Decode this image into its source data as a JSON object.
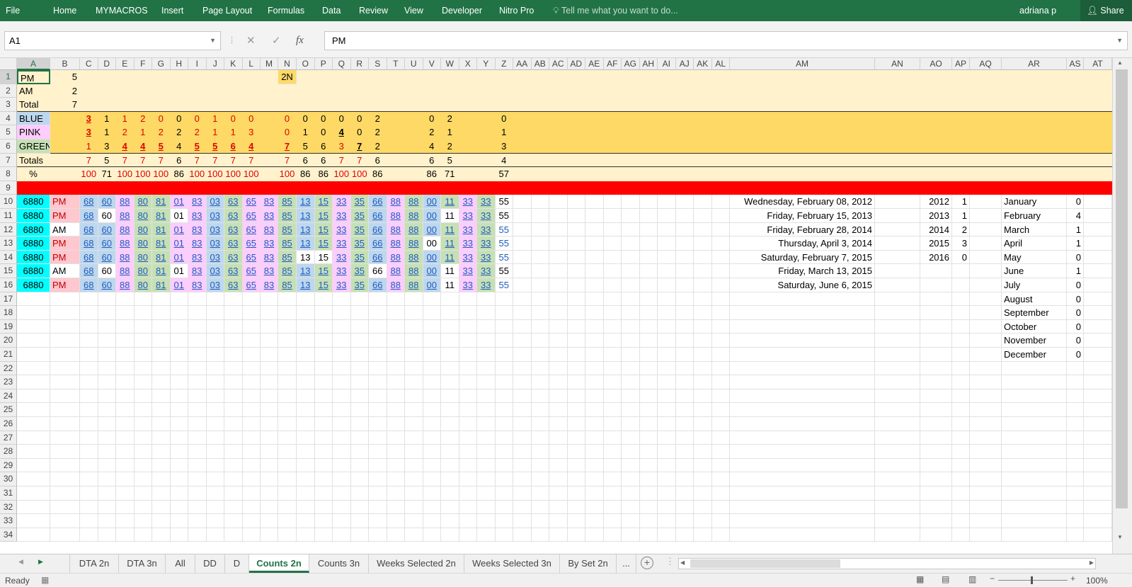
{
  "ribbon": {
    "tabs": [
      "File",
      "Home",
      "MYMACROS",
      "Insert",
      "Page Layout",
      "Formulas",
      "Data",
      "Review",
      "View",
      "Developer",
      "Nitro Pro"
    ],
    "tell_me": "Tell me what you want to do...",
    "user": "adriana p",
    "share": "Share"
  },
  "formula_bar": {
    "name_box": "A1",
    "formula": "PM",
    "fx": "fx"
  },
  "columns": [
    "A",
    "B",
    "C",
    "D",
    "E",
    "F",
    "G",
    "H",
    "I",
    "J",
    "K",
    "L",
    "M",
    "N",
    "O",
    "P",
    "Q",
    "R",
    "S",
    "T",
    "U",
    "V",
    "W",
    "X",
    "Y",
    "Z",
    "AA",
    "AB",
    "AC",
    "AD",
    "AE",
    "AF",
    "AG",
    "AH",
    "AI",
    "AJ",
    "AK",
    "AL",
    "AM",
    "AN",
    "AO",
    "AP",
    "AQ",
    "AR",
    "AS",
    "AT"
  ],
  "row_numbers": [
    "1",
    "2",
    "3",
    "4",
    "5",
    "6",
    "7",
    "8",
    "9",
    "10",
    "11",
    "12",
    "13",
    "14",
    "15",
    "16",
    "17",
    "18",
    "19",
    "20",
    "21",
    "22",
    "23",
    "24",
    "25",
    "26",
    "27",
    "28",
    "29",
    "30",
    "31",
    "32",
    "33",
    "34"
  ],
  "colors": {
    "header_bg": "#efefef",
    "band_light": "#fff2cc",
    "band_gold": "#ffd966",
    "red_row": "#ff0000",
    "cyan": "#00ffff",
    "blue": "#bdd7ee",
    "pink": "#ffccff",
    "green": "#c6e0b4",
    "ribbon": "#217346"
  },
  "sheet": {
    "summary": [
      {
        "label": "PM",
        "b": "5",
        "extra": {
          "N": "2N"
        }
      },
      {
        "label": "AM",
        "b": "2"
      },
      {
        "label": "Total",
        "b": "7"
      }
    ],
    "color_rows": [
      {
        "label": "BLUE",
        "values": [
          "3",
          "1",
          "1",
          "2",
          "0",
          "0",
          "0",
          "1",
          "0",
          "0",
          "",
          "0",
          "0",
          "0",
          "0",
          "0",
          "2",
          "",
          "",
          "0",
          "2",
          "",
          "",
          "0"
        ]
      },
      {
        "label": "PINK",
        "values": [
          "3",
          "1",
          "2",
          "1",
          "2",
          "2",
          "2",
          "1",
          "1",
          "3",
          "",
          "0",
          "1",
          "0",
          "4",
          "0",
          "2",
          "",
          "",
          "2",
          "1",
          "",
          "",
          "1"
        ]
      },
      {
        "label": "GREEN",
        "values": [
          "1",
          "3",
          "4",
          "4",
          "5",
          "4",
          "5",
          "5",
          "6",
          "4",
          "",
          "7",
          "5",
          "6",
          "3",
          "7",
          "2",
          "",
          "",
          "4",
          "2",
          "",
          "",
          "3"
        ]
      }
    ],
    "totals": {
      "label": "Totals",
      "values": [
        "7",
        "5",
        "7",
        "7",
        "7",
        "6",
        "7",
        "7",
        "7",
        "7",
        "",
        "7",
        "6",
        "6",
        "7",
        "7",
        "6",
        "",
        "",
        "6",
        "5",
        "",
        "",
        "4"
      ]
    },
    "percent": {
      "label": "%",
      "values": [
        "100",
        "71",
        "100",
        "100",
        "100",
        "86",
        "100",
        "100",
        "100",
        "100",
        "",
        "100",
        "86",
        "86",
        "100",
        "100",
        "86",
        "",
        "",
        "86",
        "71",
        "",
        "",
        "57"
      ]
    },
    "draws": [
      {
        "id": "6880",
        "ampm": "PM",
        "nums": [
          "68",
          "60",
          "88",
          "80",
          "81",
          "01",
          "83",
          "03",
          "63",
          "65",
          "83",
          "85",
          "13",
          "15",
          "33",
          "35",
          "66",
          "88",
          "88",
          "00",
          "11",
          "33",
          "33",
          "55"
        ]
      },
      {
        "id": "6880",
        "ampm": "PM",
        "nums": [
          "68",
          "60",
          "88",
          "80",
          "81",
          "01",
          "83",
          "03",
          "63",
          "65",
          "83",
          "85",
          "13",
          "15",
          "33",
          "35",
          "66",
          "88",
          "88",
          "00",
          "11",
          "33",
          "33",
          "55"
        ]
      },
      {
        "id": "6880",
        "ampm": "AM",
        "nums": [
          "68",
          "60",
          "88",
          "80",
          "81",
          "01",
          "83",
          "03",
          "63",
          "65",
          "83",
          "85",
          "13",
          "15",
          "33",
          "35",
          "66",
          "88",
          "88",
          "00",
          "11",
          "33",
          "33",
          "55"
        ]
      },
      {
        "id": "6880",
        "ampm": "PM",
        "nums": [
          "68",
          "60",
          "88",
          "80",
          "81",
          "01",
          "83",
          "03",
          "63",
          "65",
          "83",
          "85",
          "13",
          "15",
          "33",
          "35",
          "66",
          "88",
          "88",
          "00",
          "11",
          "33",
          "33",
          "55"
        ]
      },
      {
        "id": "6880",
        "ampm": "PM",
        "nums": [
          "68",
          "60",
          "88",
          "80",
          "81",
          "01",
          "83",
          "03",
          "63",
          "65",
          "83",
          "85",
          "13",
          "15",
          "33",
          "35",
          "66",
          "88",
          "88",
          "00",
          "11",
          "33",
          "33",
          "55"
        ]
      },
      {
        "id": "6880",
        "ampm": "AM",
        "nums": [
          "68",
          "60",
          "88",
          "80",
          "81",
          "01",
          "83",
          "03",
          "63",
          "65",
          "83",
          "85",
          "13",
          "15",
          "33",
          "35",
          "66",
          "88",
          "88",
          "00",
          "11",
          "33",
          "33",
          "55"
        ]
      },
      {
        "id": "6880",
        "ampm": "PM",
        "nums": [
          "68",
          "60",
          "88",
          "80",
          "81",
          "01",
          "83",
          "03",
          "63",
          "65",
          "83",
          "85",
          "13",
          "15",
          "33",
          "35",
          "66",
          "88",
          "88",
          "00",
          "11",
          "33",
          "33",
          "55"
        ]
      }
    ],
    "dates": [
      "Wednesday, February 08, 2012",
      "Friday, February 15, 2013",
      "Friday, February 28, 2014",
      "Thursday, April 3, 2014",
      "Saturday, February 7, 2015",
      "Friday, March 13, 2015",
      "Saturday, June 6, 2015"
    ],
    "year_counts": [
      {
        "year": "2012",
        "count": "1"
      },
      {
        "year": "2013",
        "count": "1"
      },
      {
        "year": "2014",
        "count": "2"
      },
      {
        "year": "2015",
        "count": "3"
      },
      {
        "year": "2016",
        "count": "0"
      }
    ],
    "month_counts": [
      {
        "month": "January",
        "count": "0"
      },
      {
        "month": "February",
        "count": "4"
      },
      {
        "month": "March",
        "count": "1"
      },
      {
        "month": "April",
        "count": "1"
      },
      {
        "month": "May",
        "count": "0"
      },
      {
        "month": "June",
        "count": "1"
      },
      {
        "month": "July",
        "count": "0"
      },
      {
        "month": "August",
        "count": "0"
      },
      {
        "month": "September",
        "count": "0"
      },
      {
        "month": "October",
        "count": "0"
      },
      {
        "month": "November",
        "count": "0"
      },
      {
        "month": "December",
        "count": "0"
      }
    ]
  },
  "sheet_tabs": [
    "DTA 2n",
    "DTA 3n",
    "All",
    "DD",
    "D",
    "Counts 2n",
    "Counts 3n",
    "Weeks Selected 2n",
    "Weeks Selected 3n",
    "By Set 2n",
    "..."
  ],
  "active_tab": "Counts 2n",
  "status": {
    "ready": "Ready",
    "zoom": "100%"
  }
}
